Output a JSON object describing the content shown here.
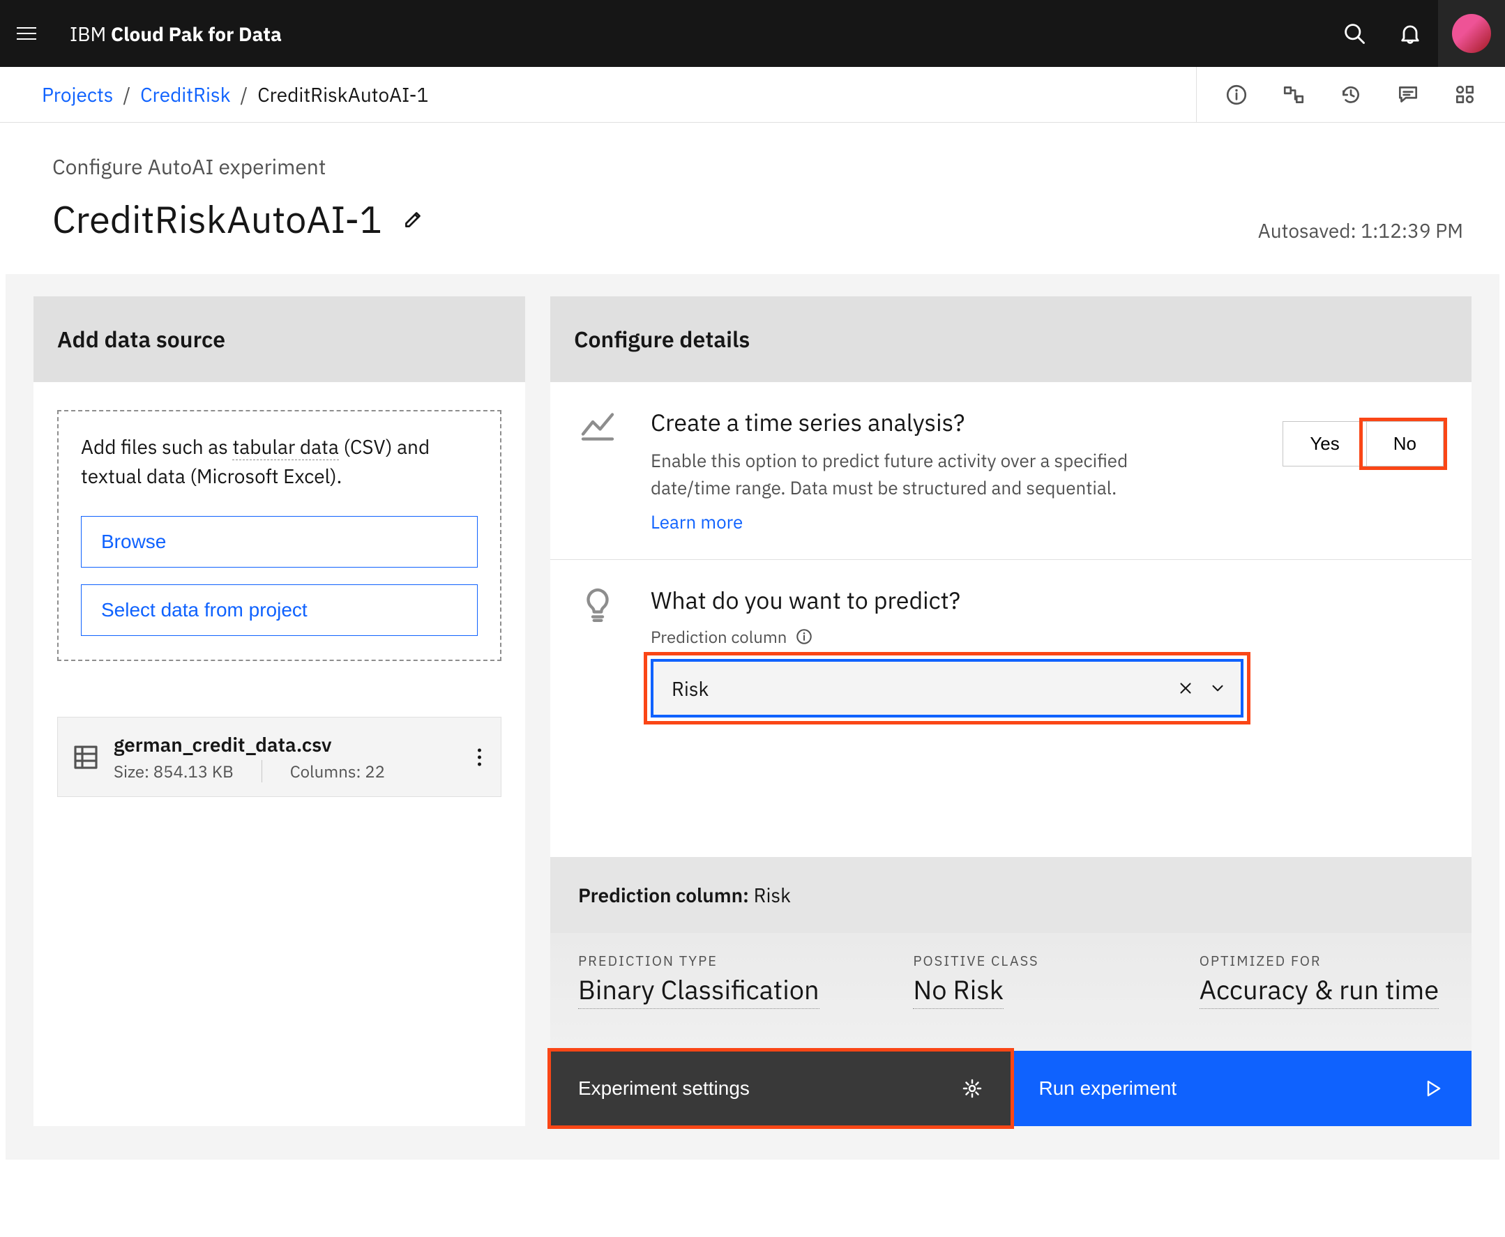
{
  "brand": {
    "prefix": "IBM ",
    "bold": "Cloud Pak for Data"
  },
  "breadcrumb": {
    "projects": "Projects",
    "project_name": "CreditRisk",
    "current": "CreditRiskAutoAI-1"
  },
  "header": {
    "kicker": "Configure AutoAI experiment",
    "title": "CreditRiskAutoAI-1",
    "autosaved": "Autosaved: 1:12:39 PM"
  },
  "addDataSource": {
    "panel_title": "Add data source",
    "hint_pre": "Add files such as ",
    "hint_dotted": "tabular data",
    "hint_post": " (CSV) and textual data (Microsoft Excel).",
    "browse": "Browse",
    "select_project": "Select data from project",
    "file": {
      "name": "german_credit_data.csv",
      "size_label": "Size: 854.13 KB",
      "cols_label": "Columns: 22"
    }
  },
  "configure": {
    "panel_title": "Configure details",
    "timeseries": {
      "title": "Create a time series analysis?",
      "desc": "Enable this option to predict future activity over a specified date/time range. Data must be structured and sequential.",
      "learn": "Learn more",
      "yes": "Yes",
      "no": "No"
    },
    "predict": {
      "title": "What do you want to predict?",
      "label": "Prediction column",
      "selected": "Risk"
    },
    "summary": {
      "pred_col_label": "Prediction column:",
      "pred_col_value": " Risk",
      "type_label": "PREDICTION TYPE",
      "type_value": "Binary Classification",
      "class_label": "POSITIVE CLASS",
      "class_value": "No Risk",
      "opt_label": "OPTIMIZED FOR",
      "opt_value": "Accuracy & run time"
    },
    "actions": {
      "settings": "Experiment settings",
      "run": "Run experiment"
    }
  }
}
